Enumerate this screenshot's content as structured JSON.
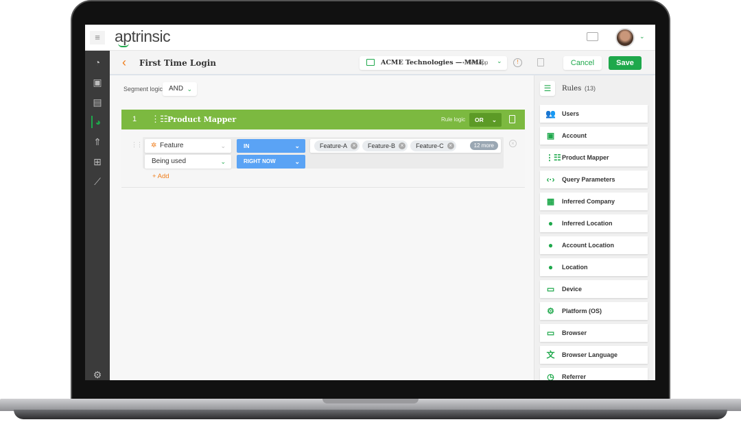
{
  "app": {
    "logo": "aptrinsic"
  },
  "header": {
    "menu_icon": "hamburger-icon",
    "chat_icon": "chat-icon",
    "avatar_icon": "avatar"
  },
  "sidebar": {
    "items": [
      {
        "icon": "speedometer-icon"
      },
      {
        "icon": "user-card-icon"
      },
      {
        "icon": "briefcase-icon"
      },
      {
        "icon": "pie-chart-icon"
      },
      {
        "icon": "rocket-icon"
      },
      {
        "icon": "hierarchy-icon"
      },
      {
        "icon": "line-chart-icon"
      }
    ],
    "settings_icon": "gear-icon"
  },
  "subheader": {
    "title": "First Time Login",
    "product": "ACME Technologies — MME",
    "product_type": "• Web App",
    "cancel": "Cancel",
    "save": "Save"
  },
  "segment": {
    "label": "Segment logic",
    "value": "AND"
  },
  "rule_group": {
    "number": "1",
    "title": "Product Mapper",
    "logic_label": "Rule logic",
    "logic_value": "OR",
    "condition": {
      "field": "Feature",
      "operator": "IN",
      "chips": [
        "Feature-A",
        "Feature-B",
        "Feature-C"
      ],
      "more": "12 more",
      "usage": "Being used",
      "time": "RIGHT NOW"
    },
    "add": "+ Add"
  },
  "rules_panel": {
    "title": "Rules",
    "count": "(13)",
    "items": [
      {
        "label": "Users",
        "icon": "users-icon"
      },
      {
        "label": "Account",
        "icon": "account-icon"
      },
      {
        "label": "Product Mapper",
        "icon": "product-mapper-icon"
      },
      {
        "label": "Query Parameters",
        "icon": "code-icon"
      },
      {
        "label": "Inferred Company",
        "icon": "building-icon"
      },
      {
        "label": "Inferred Location",
        "icon": "globe-icon"
      },
      {
        "label": "Account Location",
        "icon": "globe-icon"
      },
      {
        "label": "Location",
        "icon": "globe-icon"
      },
      {
        "label": "Device",
        "icon": "devices-icon"
      },
      {
        "label": "Platform (OS)",
        "icon": "platform-icon"
      },
      {
        "label": "Browser",
        "icon": "browser-icon"
      },
      {
        "label": "Browser Language",
        "icon": "translate-icon"
      },
      {
        "label": "Referrer",
        "icon": "clock-icon"
      }
    ]
  },
  "colors": {
    "accent": "#1ea84b",
    "group_header": "#7cb940",
    "operator": "#5aa3f5",
    "orange": "#f07d1a"
  }
}
